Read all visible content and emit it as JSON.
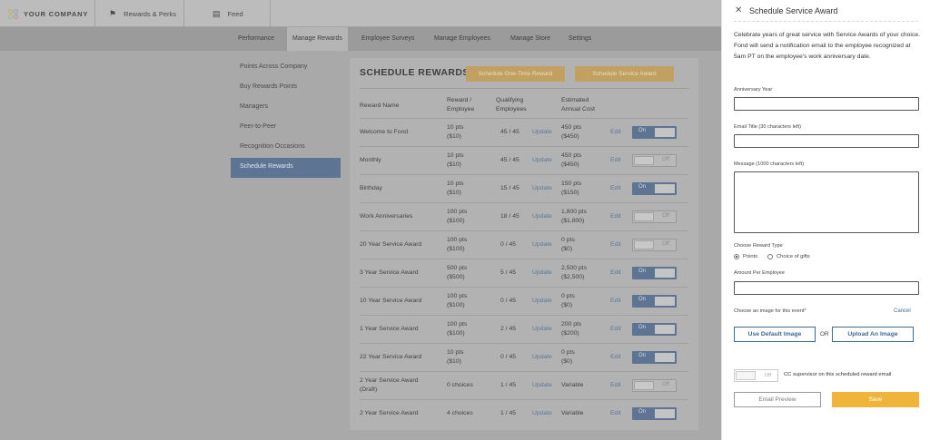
{
  "topbar": {
    "company": "YOUR COMPANY",
    "rewards": "Rewards & Perks",
    "feed": "Feed"
  },
  "subnav": [
    "Performance",
    "Manage Rewards",
    "Employee Surveys",
    "Manage Employees",
    "Manage Store",
    "Settings"
  ],
  "sidebar": [
    "Points Across Company",
    "Buy Rewards Points",
    "Managers",
    "Peer-to-Peer",
    "Recognition Occasions",
    "Schedule Rewards"
  ],
  "main": {
    "title": "SCHEDULE REWARDS",
    "btn_one_time": "Schedule One-Time Reward",
    "btn_service": "Schedule Service Award",
    "headers": {
      "name": "Reward Name",
      "reward1": "Reward /",
      "reward2": "Employee",
      "qual1": "Qualifying",
      "qual2": "Employees",
      "cost1": "Estimated",
      "cost2": "Annual Cost"
    },
    "rows": [
      {
        "name1": "Welcome to Fond",
        "name2": "",
        "r1": "10 pts",
        "r2": "($10)",
        "q": "45 / 45",
        "update": "Update",
        "c1": "450 pts",
        "c2": "($450)",
        "edit": "Edit",
        "on": true
      },
      {
        "name1": "Monthly",
        "name2": "",
        "r1": "10 pts",
        "r2": "($10)",
        "q": "45 / 45",
        "update": "Update",
        "c1": "450 pts",
        "c2": "($450)",
        "edit": "Edit",
        "on": false
      },
      {
        "name1": "Birthday",
        "name2": "",
        "r1": "10 pts",
        "r2": "($10)",
        "q": "15 / 45",
        "update": "Update",
        "c1": "150 pts",
        "c2": "($150)",
        "edit": "Edit",
        "on": true
      },
      {
        "name1": "Work Anniversaries",
        "name2": "",
        "r1": "100 pts",
        "r2": "($100)",
        "q": "18 / 45",
        "update": "Update",
        "c1": "1,800 pts",
        "c2": "($1,800)",
        "edit": "Edit",
        "on": false
      },
      {
        "name1": "20 Year Service Award",
        "name2": "",
        "r1": "100 pts",
        "r2": "($100)",
        "q": "0 / 45",
        "update": "Update",
        "c1": "0 pts",
        "c2": "($0)",
        "edit": "Edit",
        "on": false
      },
      {
        "name1": "3 Year Service Award",
        "name2": "",
        "r1": "500 pts",
        "r2": "($500)",
        "q": "5 / 45",
        "update": "Update",
        "c1": "2,500 pts",
        "c2": "($2,500)",
        "edit": "Edit",
        "on": true
      },
      {
        "name1": "10 Year Service Award",
        "name2": "",
        "r1": "100 pts",
        "r2": "($100)",
        "q": "0 / 45",
        "update": "Update",
        "c1": "0 pts",
        "c2": "($0)",
        "edit": "Edit",
        "on": true
      },
      {
        "name1": "1 Year Service Award",
        "name2": "",
        "r1": "100 pts",
        "r2": "($100)",
        "q": "2 / 45",
        "update": "Update",
        "c1": "200 pts",
        "c2": "($200)",
        "edit": "Edit",
        "on": true
      },
      {
        "name1": "22 Year Service Award",
        "name2": "",
        "r1": "10 pts",
        "r2": "($10)",
        "q": "0 / 45",
        "update": "Update",
        "c1": "0 pts",
        "c2": "($0)",
        "edit": "Edit",
        "on": true
      },
      {
        "name1": "2 Year Service Award",
        "name2": "(Draft)",
        "r1": "0 choices",
        "r2": "",
        "q": "1 / 45",
        "update": "Update",
        "c1": "Variable",
        "c2": "",
        "edit": "Edit",
        "on": false
      },
      {
        "name1": "2 Year Service Award",
        "name2": "",
        "r1": "4 choices",
        "r2": "",
        "q": "1 / 45",
        "update": "Update",
        "c1": "Variable",
        "c2": "",
        "edit": "Edit",
        "on": true
      }
    ],
    "toggle_on": "On",
    "toggle_off": "Off"
  },
  "drawer": {
    "title": "Schedule Service Award",
    "description": "Celebrate years of great service with Service Awards of your choice. Fond will send a notification email to the employee recognized at 5am PT on the employee's work anniversary date.",
    "anniversary_label": "Anniversary Year",
    "email_title_label": "Email Title (30 characters left)",
    "message_label": "Message (1000 characters left)",
    "reward_type_label": "Choose Reward Type",
    "option_points": "Points",
    "option_gifts": "Choice of gifts",
    "amount_label": "Amount Per Employee",
    "image_label": "Choose an image for this event*",
    "cancel": "Cancel",
    "use_default": "Use Default Image",
    "or": "OR",
    "upload": "Upload An Image",
    "cc_toggle": "Off",
    "cc_label": "CC supervisor on this scheduled reward email",
    "preview": "Email Preview",
    "save": "Save"
  },
  "colors": {
    "accent_blue": "#3f6a97",
    "save_orange": "#f0b43b",
    "toggle_on": "#5d7592"
  }
}
